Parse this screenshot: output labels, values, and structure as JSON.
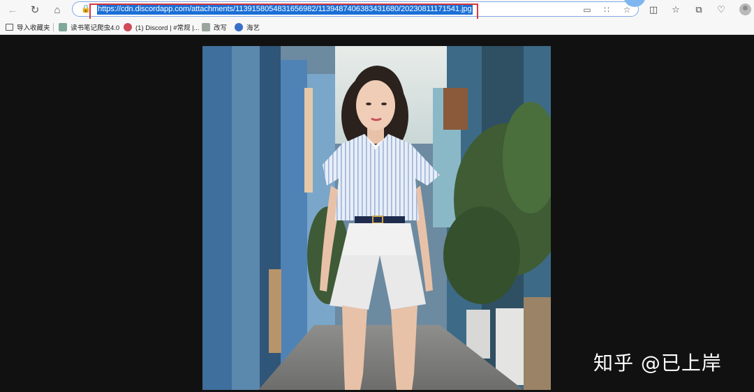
{
  "toolbar": {
    "back_icon": "back-arrow-icon",
    "refresh_icon": "refresh-icon",
    "home_icon": "home-icon",
    "url": "https://cdn.discordapp.com/attachments/1139158054831656982/1139487406383431680/20230811171541.jpg",
    "highlight_color": "#d9363a",
    "selection_color": "#1a6fd6"
  },
  "favorites": [
    {
      "label": "导入收藏夹",
      "icon": "folder-import-icon",
      "color": "#555555"
    },
    {
      "label": "读书笔记爬虫4.0",
      "icon": "page-icon",
      "color": "#7fa89a"
    },
    {
      "label": "(1) Discord | #常规 |...",
      "icon": "discord-icon",
      "color": "#d04a5a"
    },
    {
      "label": "改写",
      "icon": "page-icon",
      "color": "#9aa59d"
    },
    {
      "label": "海艺",
      "icon": "seaart-icon",
      "color": "#3a6fc6"
    }
  ],
  "viewer": {
    "background": "#111111"
  },
  "watermark": {
    "text": "知乎 @已上岸"
  }
}
